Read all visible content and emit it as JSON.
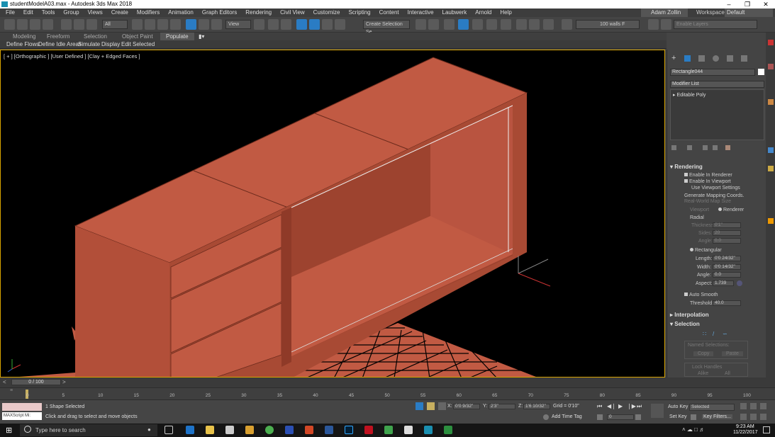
{
  "window": {
    "title": "studentModelA03.max - Autodesk 3ds Max 2018",
    "minimize": "–",
    "maximize": "❐",
    "close": "✕"
  },
  "menu": {
    "items": [
      "File",
      "Edit",
      "Tools",
      "Group",
      "Views",
      "Create",
      "Modifiers",
      "Animation",
      "Graph Editors",
      "Rendering",
      "Civil View",
      "Customize",
      "Scripting",
      "Content",
      "Interactive",
      "Laubwerk",
      "Arnold",
      "Help"
    ],
    "user": "Adam Zollin",
    "workspaces_label": "Workspaces:",
    "workspace_value": "Default"
  },
  "toolbar": {
    "filter_value": "All",
    "ref_coord_value": "View",
    "selection_set_placeholder": "Create Selection Se",
    "walls_value": "100 walls F",
    "layer_placeholder": "Enable Layers"
  },
  "ribbon": {
    "tabs": [
      "Modeling",
      "Freeform",
      "Selection",
      "Object Paint",
      "Populate"
    ],
    "populate_tools": [
      "Define Flows",
      "Define Idle Areas",
      "Simulate",
      "Display",
      "Edit Selected"
    ]
  },
  "viewport": {
    "label": "[ + ] [Orthographic ] [User Defined ] [Clay + Edged Faces ]",
    "object_color": "#c15a43",
    "object_dark": "#8f3a28",
    "object_mid": "#a84a34"
  },
  "command_panel": {
    "object_name": "Rectangle044",
    "modifier_list": "Modifier List",
    "stack_item": "Editable Poly",
    "rendering": {
      "header": "Rendering",
      "enable_renderer": "Enable In Renderer",
      "enable_viewport": "Enable In Viewport",
      "use_viewport": "Use Viewport Settings",
      "gen_mapping": "Generate Mapping Coords.",
      "real_world": "Real-World Map Size",
      "viewport_opt": "Viewport",
      "renderer_opt": "Renderer",
      "radial": "Radial",
      "thickness_label": "Thickness:",
      "thickness_value": "0'1\"",
      "sides_label": "Sides:",
      "sides_value": "20",
      "angle_label": "Angle:",
      "angle_value": "0.0",
      "rectangular": "Rectangular",
      "length_label": "Length:",
      "length_value": "0'0 24/32\"",
      "width_label": "Width:",
      "width_value": "0'0 14/32\"",
      "angle2_label": "Angle:",
      "angle2_value": "0.0",
      "aspect_label": "Aspect:",
      "aspect_value": "1.739",
      "auto_smooth": "Auto Smooth",
      "threshold_label": "Threshold:",
      "threshold_value": "40.0"
    },
    "interpolation": "Interpolation",
    "selection": {
      "header": "Selection",
      "named_selections": "Named Selections:",
      "copy": "Copy",
      "paste": "Paste",
      "lock_handles": "Lock Handles",
      "alike": "Alike",
      "all": "All"
    }
  },
  "timeline": {
    "frame_display": "0 / 100",
    "prev": "<",
    "next": ">",
    "ticks": [
      "0",
      "5",
      "10",
      "15",
      "20",
      "25",
      "30",
      "35",
      "40",
      "45",
      "50",
      "55",
      "60",
      "65",
      "70",
      "75",
      "80",
      "85",
      "90",
      "95",
      "100"
    ]
  },
  "status": {
    "maxscript": "MAXScript Mi:",
    "selected": "1 Shape Selected",
    "prompt": "Click and drag to select and move objects",
    "x_label": "X:",
    "x_value": "0'0 9/32\"",
    "y_label": "Y:",
    "y_value": "2'3\"",
    "z_label": "Z:",
    "z_value": "1'6 10/32\"",
    "grid": "Grid = 0'10\"",
    "add_time_tag": "Add Time Tag",
    "auto_key": "Auto Key",
    "set_key": "Set Key",
    "key_mode": "Selected",
    "key_filters": "Key Filters...",
    "frame_spinner": "0"
  },
  "taskbar": {
    "search_placeholder": "Type here to search",
    "time": "9:23 AM",
    "date": "11/22/2017"
  }
}
